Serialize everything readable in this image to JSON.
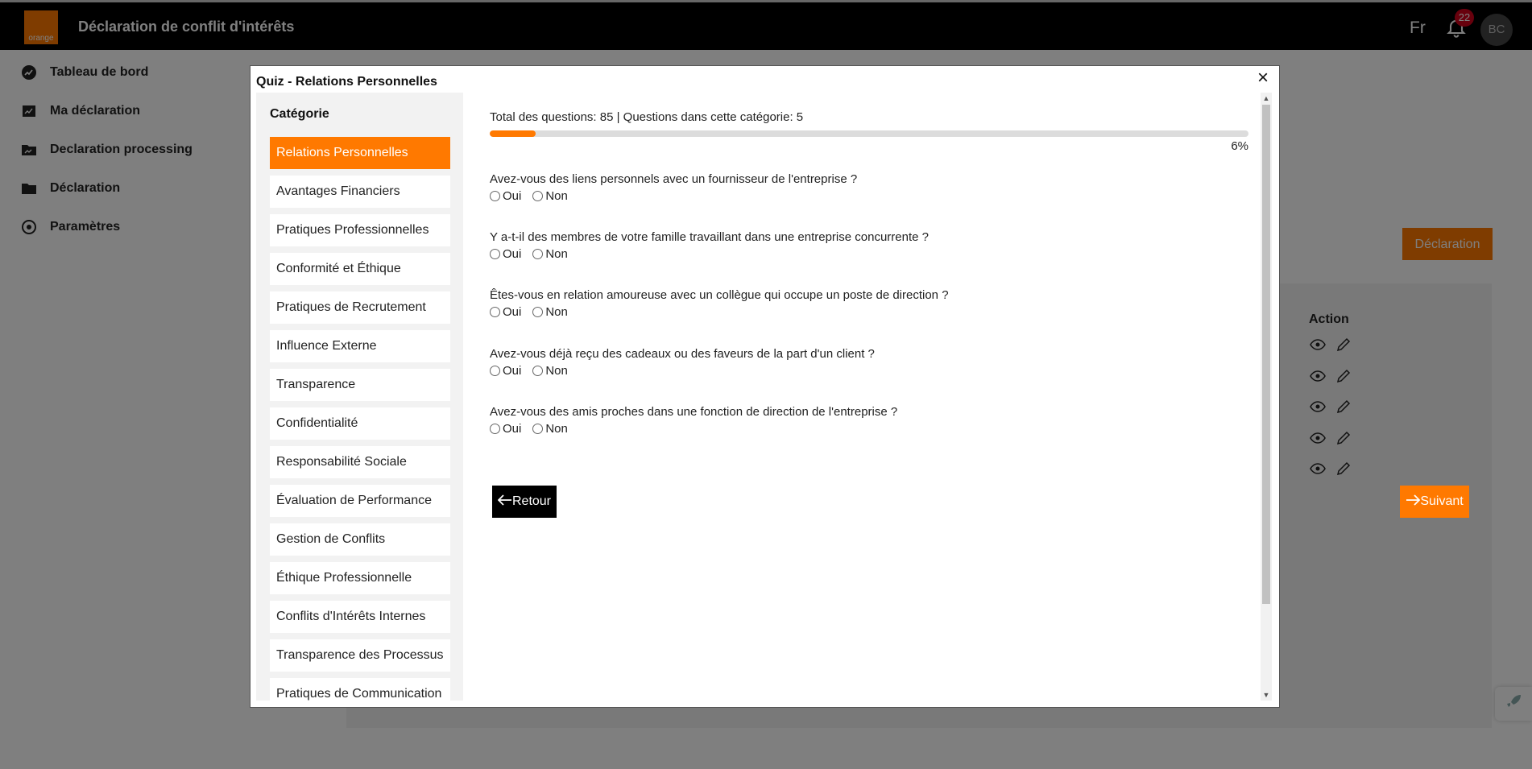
{
  "app": {
    "brand": "orange",
    "title": "Déclaration de conflit d'intérêts",
    "language": "Fr",
    "notifications": "22",
    "avatar": "BC"
  },
  "sidebar": {
    "items": [
      {
        "label": "Tableau de bord",
        "icon": "dashboard-icon"
      },
      {
        "label": "Ma déclaration",
        "icon": "document-icon"
      },
      {
        "label": "Declaration processing",
        "icon": "folder-chart-icon"
      },
      {
        "label": "Déclaration",
        "icon": "folder-icon"
      },
      {
        "label": "Paramètres",
        "icon": "settings-icon"
      }
    ]
  },
  "main": {
    "declaration_button": "Déclaration",
    "action_header": "Action"
  },
  "modal": {
    "title": "Quiz - Relations Personnelles",
    "category_heading": "Catégorie",
    "categories": [
      "Relations Personnelles",
      "Avantages Financiers",
      "Pratiques Professionnelles",
      "Conformité et Éthique",
      "Pratiques de Recrutement",
      "Influence Externe",
      "Transparence",
      "Confidentialité",
      "Responsabilité Sociale",
      "Évaluation de Performance",
      "Gestion de Conflits",
      "Éthique Professionnelle",
      "Conflits d'Intérêts Internes",
      "Transparence des Processus",
      "Pratiques de Communication"
    ],
    "active_category": "Relations Personnelles",
    "info": "Total des questions: 85 | Questions dans cette catégorie: 5",
    "progress": 0.06,
    "progress_label": "6%",
    "option_yes": "Oui",
    "option_no": "Non",
    "questions": [
      "Avez-vous des liens personnels avec un fournisseur de l'entreprise ?",
      "Y a-t-il des membres de votre famille travaillant dans une entreprise concurrente ?",
      "Êtes-vous en relation amoureuse avec un collègue qui occupe un poste de direction ?",
      "Avez-vous déjà reçu des cadeaux ou des faveurs de la part d'un client ?",
      "Avez-vous des amis proches dans une fonction de direction de l'entreprise ?"
    ],
    "back_label": "Retour",
    "next_label": "Suivant"
  },
  "colors": {
    "accent": "#ff7900",
    "topbar": "#000000",
    "badge": "#d0021b"
  }
}
